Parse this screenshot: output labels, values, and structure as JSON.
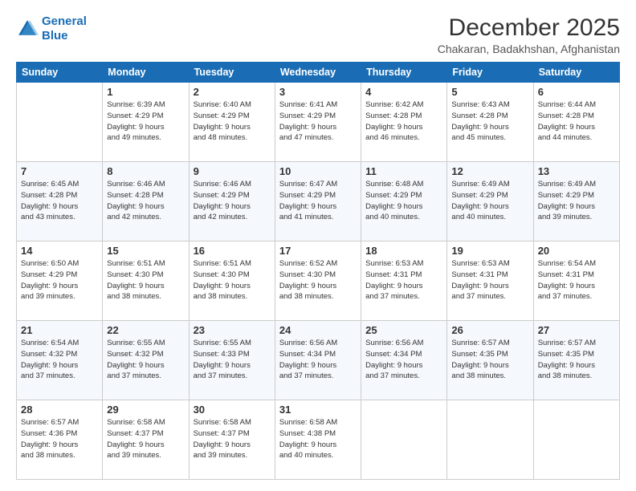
{
  "logo": {
    "line1": "General",
    "line2": "Blue"
  },
  "title": "December 2025",
  "subtitle": "Chakaran, Badakhshan, Afghanistan",
  "days_header": [
    "Sunday",
    "Monday",
    "Tuesday",
    "Wednesday",
    "Thursday",
    "Friday",
    "Saturday"
  ],
  "weeks": [
    [
      {
        "day": "",
        "info": ""
      },
      {
        "day": "1",
        "info": "Sunrise: 6:39 AM\nSunset: 4:29 PM\nDaylight: 9 hours\nand 49 minutes."
      },
      {
        "day": "2",
        "info": "Sunrise: 6:40 AM\nSunset: 4:29 PM\nDaylight: 9 hours\nand 48 minutes."
      },
      {
        "day": "3",
        "info": "Sunrise: 6:41 AM\nSunset: 4:29 PM\nDaylight: 9 hours\nand 47 minutes."
      },
      {
        "day": "4",
        "info": "Sunrise: 6:42 AM\nSunset: 4:28 PM\nDaylight: 9 hours\nand 46 minutes."
      },
      {
        "day": "5",
        "info": "Sunrise: 6:43 AM\nSunset: 4:28 PM\nDaylight: 9 hours\nand 45 minutes."
      },
      {
        "day": "6",
        "info": "Sunrise: 6:44 AM\nSunset: 4:28 PM\nDaylight: 9 hours\nand 44 minutes."
      }
    ],
    [
      {
        "day": "7",
        "info": "Sunrise: 6:45 AM\nSunset: 4:28 PM\nDaylight: 9 hours\nand 43 minutes."
      },
      {
        "day": "8",
        "info": "Sunrise: 6:46 AM\nSunset: 4:28 PM\nDaylight: 9 hours\nand 42 minutes."
      },
      {
        "day": "9",
        "info": "Sunrise: 6:46 AM\nSunset: 4:29 PM\nDaylight: 9 hours\nand 42 minutes."
      },
      {
        "day": "10",
        "info": "Sunrise: 6:47 AM\nSunset: 4:29 PM\nDaylight: 9 hours\nand 41 minutes."
      },
      {
        "day": "11",
        "info": "Sunrise: 6:48 AM\nSunset: 4:29 PM\nDaylight: 9 hours\nand 40 minutes."
      },
      {
        "day": "12",
        "info": "Sunrise: 6:49 AM\nSunset: 4:29 PM\nDaylight: 9 hours\nand 40 minutes."
      },
      {
        "day": "13",
        "info": "Sunrise: 6:49 AM\nSunset: 4:29 PM\nDaylight: 9 hours\nand 39 minutes."
      }
    ],
    [
      {
        "day": "14",
        "info": "Sunrise: 6:50 AM\nSunset: 4:29 PM\nDaylight: 9 hours\nand 39 minutes."
      },
      {
        "day": "15",
        "info": "Sunrise: 6:51 AM\nSunset: 4:30 PM\nDaylight: 9 hours\nand 38 minutes."
      },
      {
        "day": "16",
        "info": "Sunrise: 6:51 AM\nSunset: 4:30 PM\nDaylight: 9 hours\nand 38 minutes."
      },
      {
        "day": "17",
        "info": "Sunrise: 6:52 AM\nSunset: 4:30 PM\nDaylight: 9 hours\nand 38 minutes."
      },
      {
        "day": "18",
        "info": "Sunrise: 6:53 AM\nSunset: 4:31 PM\nDaylight: 9 hours\nand 37 minutes."
      },
      {
        "day": "19",
        "info": "Sunrise: 6:53 AM\nSunset: 4:31 PM\nDaylight: 9 hours\nand 37 minutes."
      },
      {
        "day": "20",
        "info": "Sunrise: 6:54 AM\nSunset: 4:31 PM\nDaylight: 9 hours\nand 37 minutes."
      }
    ],
    [
      {
        "day": "21",
        "info": "Sunrise: 6:54 AM\nSunset: 4:32 PM\nDaylight: 9 hours\nand 37 minutes."
      },
      {
        "day": "22",
        "info": "Sunrise: 6:55 AM\nSunset: 4:32 PM\nDaylight: 9 hours\nand 37 minutes."
      },
      {
        "day": "23",
        "info": "Sunrise: 6:55 AM\nSunset: 4:33 PM\nDaylight: 9 hours\nand 37 minutes."
      },
      {
        "day": "24",
        "info": "Sunrise: 6:56 AM\nSunset: 4:34 PM\nDaylight: 9 hours\nand 37 minutes."
      },
      {
        "day": "25",
        "info": "Sunrise: 6:56 AM\nSunset: 4:34 PM\nDaylight: 9 hours\nand 37 minutes."
      },
      {
        "day": "26",
        "info": "Sunrise: 6:57 AM\nSunset: 4:35 PM\nDaylight: 9 hours\nand 38 minutes."
      },
      {
        "day": "27",
        "info": "Sunrise: 6:57 AM\nSunset: 4:35 PM\nDaylight: 9 hours\nand 38 minutes."
      }
    ],
    [
      {
        "day": "28",
        "info": "Sunrise: 6:57 AM\nSunset: 4:36 PM\nDaylight: 9 hours\nand 38 minutes."
      },
      {
        "day": "29",
        "info": "Sunrise: 6:58 AM\nSunset: 4:37 PM\nDaylight: 9 hours\nand 39 minutes."
      },
      {
        "day": "30",
        "info": "Sunrise: 6:58 AM\nSunset: 4:37 PM\nDaylight: 9 hours\nand 39 minutes."
      },
      {
        "day": "31",
        "info": "Sunrise: 6:58 AM\nSunset: 4:38 PM\nDaylight: 9 hours\nand 40 minutes."
      },
      {
        "day": "",
        "info": ""
      },
      {
        "day": "",
        "info": ""
      },
      {
        "day": "",
        "info": ""
      }
    ]
  ]
}
